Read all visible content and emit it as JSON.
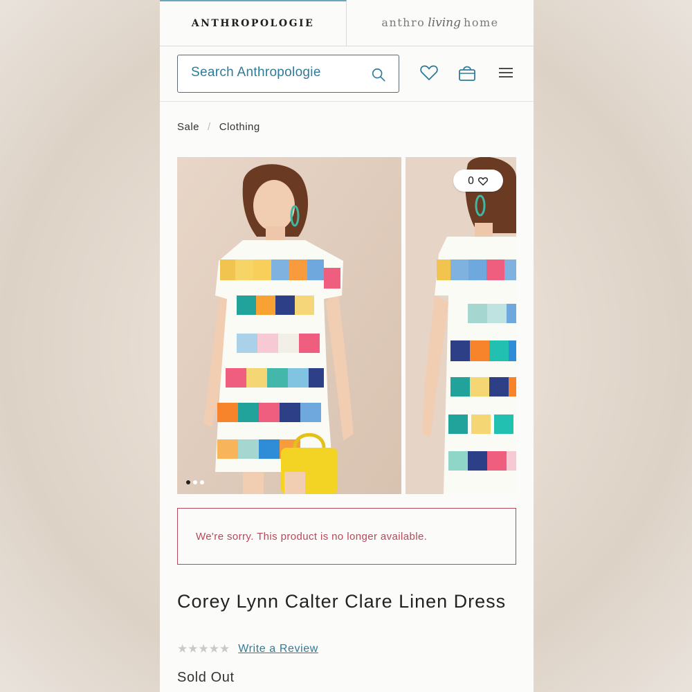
{
  "brand_tabs": {
    "main": "ANTHROPOLOGIE",
    "living_left": "anthro",
    "living_script": "living",
    "living_right": "home"
  },
  "search": {
    "placeholder": "Search Anthropologie"
  },
  "icons": {
    "search": "search-icon",
    "wishlist": "heart-icon",
    "bag": "shopping-bag-icon",
    "menu": "hamburger-menu-icon"
  },
  "breadcrumb": {
    "items": [
      "Sale",
      "Clothing"
    ],
    "separator": "/"
  },
  "gallery": {
    "like_count": "0",
    "dots_total": 3,
    "active_dot": 0
  },
  "alert": {
    "message": "We're sorry. This product is no longer available."
  },
  "product": {
    "title": "Corey Lynn Calter Clare Linen Dress",
    "rating_stars": "★★★★★",
    "rating_value": 0,
    "write_review": "Write a Review",
    "status": "Sold Out"
  },
  "colors": {
    "accent": "#2f7a9a",
    "alert": "#b5485a",
    "active_tab_border": "#6aa4bd"
  }
}
